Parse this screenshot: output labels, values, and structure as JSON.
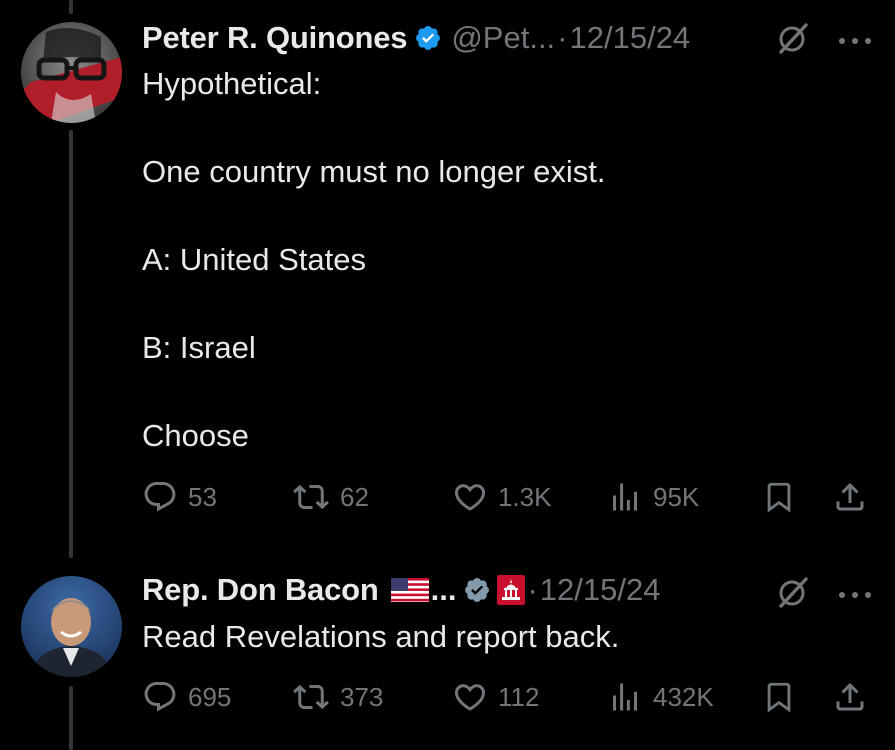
{
  "tweets": [
    {
      "author": {
        "name": "Peter R. Quinones",
        "handle": "@Pet...",
        "verified": true,
        "avatar": "avatar-photo-red-stripe"
      },
      "separator": "·",
      "timestamp": "12/15/24",
      "text_lines": [
        "Hypothetical:",
        "",
        "One country must no longer exist.",
        "",
        "A: United States",
        "",
        "B: Israel",
        "",
        "Choose"
      ],
      "stats": {
        "replies": "53",
        "reposts": "62",
        "likes": "1.3K",
        "views": "95K"
      }
    },
    {
      "author": {
        "name": "Rep. Don Bacon",
        "name_suffix": "...",
        "flag": "us-flag-icon",
        "verified": true,
        "verification_color": "gray",
        "affiliation": "us-capitol-badge-icon",
        "avatar": "avatar-photo-man-smiling"
      },
      "separator": "·",
      "timestamp": "12/15/24",
      "text_lines": [
        "Read Revelations and report back."
      ],
      "stats": {
        "replies": "695",
        "reposts": "373",
        "likes": "112",
        "views": "432K"
      }
    }
  ],
  "icons": {
    "reply": "comment-icon",
    "repost": "repost-icon",
    "like": "heart-icon",
    "views": "views-bar-icon",
    "bookmark": "bookmark-icon",
    "share": "share-icon",
    "grok": "grok-icon",
    "more": "more-icon"
  },
  "colors": {
    "background": "#000000",
    "text_primary": "#e7e9ea",
    "text_secondary": "#71767b",
    "verified_blue": "#1d9bf0",
    "verified_gray": "#829aab",
    "thread_line": "#333639"
  }
}
